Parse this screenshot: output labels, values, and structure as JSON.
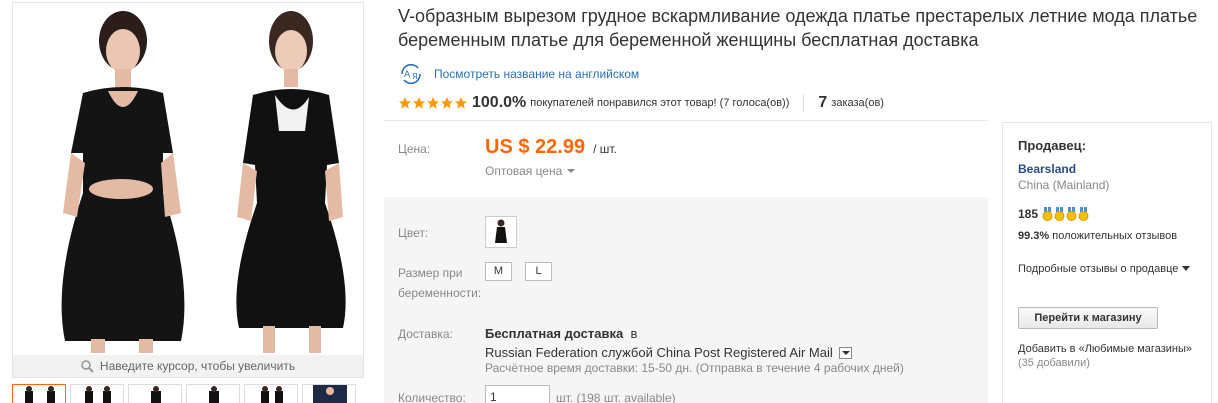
{
  "gallery": {
    "zoom_hint": "Наведите курсор, чтобы увеличить",
    "thumbnail_count": 6
  },
  "product": {
    "title": "V-образным вырезом грудное вскармливание одежда платье престарелых летние мода платье беременным платье для беременной женщины бесплатная доставка",
    "translate_link": "Посмотреть название на английском",
    "rating_percent": "100.0%",
    "rating_text": "покупателей понравился этот товар! (7 голоса(ов))",
    "stars": 5,
    "orders_count": "7",
    "orders_label": "заказа(ов)"
  },
  "price": {
    "label": "Цена:",
    "amount": "US $ 22.99",
    "unit": "/ шт.",
    "wholesale": "Оптовая цена"
  },
  "options": {
    "color_label": "Цвет:",
    "size_label": "Размер при беременности:",
    "sizes": [
      "M",
      "L"
    ]
  },
  "shipping": {
    "label": "Доставка:",
    "free": "Бесплатная доставка",
    "free_suffix": "в",
    "route": "Russian Federation службой China Post Registered Air Mail",
    "estimate": "Расчётное время доставки: 15-50 дн. (Отправка в течение 4 рабочих дней)"
  },
  "quantity": {
    "label": "Количество:",
    "value": "1",
    "available": "шт. (198 шт. available)"
  },
  "seller": {
    "heading": "Продавец:",
    "name": "Bearsland",
    "country": "China (Mainland)",
    "score": "185",
    "medals": 4,
    "feedback_pct": "99.3%",
    "feedback_text": "положительных отзывов",
    "detail_link": "Подробные отзывы о продавце",
    "store_button": "Перейти к магазину",
    "favorites_text": "Добавить в «Любимые магазины»",
    "favorites_count": "(35 добавили)"
  },
  "colors": {
    "price": "#ff6600",
    "link": "#2b6fb6",
    "star": "#ff9900",
    "panel_bg": "#f5f5f5"
  }
}
